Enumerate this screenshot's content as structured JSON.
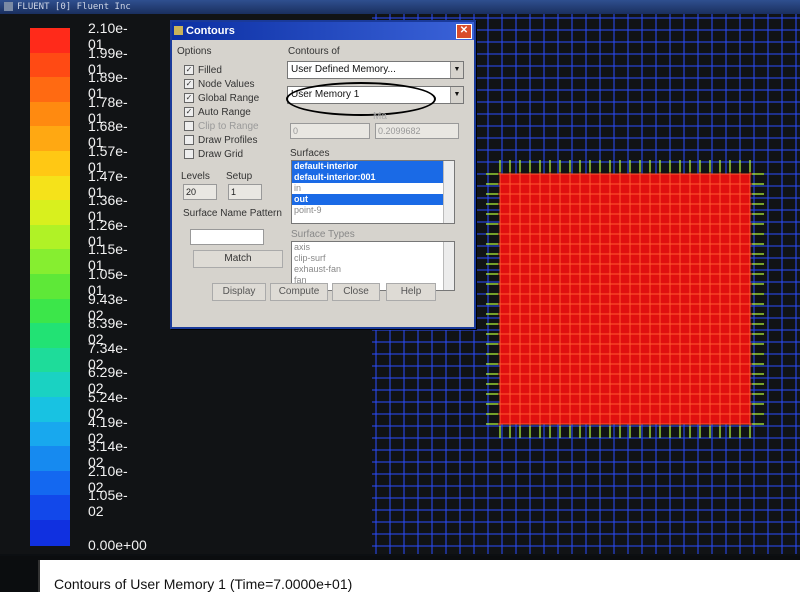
{
  "window": {
    "title": "FLUENT [0] Fluent Inc"
  },
  "colorbar": {
    "labels": [
      "2.10e-01",
      "1.99e-01",
      "1.89e-01",
      "1.78e-01",
      "1.68e-01",
      "1.57e-01",
      "1.47e-01",
      "1.36e-01",
      "1.26e-01",
      "1.15e-01",
      "1.05e-01",
      "9.43e-02",
      "8.39e-02",
      "7.34e-02",
      "6.29e-02",
      "5.24e-02",
      "4.19e-02",
      "3.14e-02",
      "2.10e-02",
      "1.05e-02",
      "0.00e+00"
    ],
    "colors": [
      "#ff2a1a",
      "#ff4a14",
      "#ff6a12",
      "#ff8a10",
      "#ffa812",
      "#ffc814",
      "#f5e21a",
      "#d8f01e",
      "#b0f226",
      "#86ee30",
      "#5ee838",
      "#3ce64a",
      "#22e274",
      "#1edc9a",
      "#1ad2c2",
      "#18c2e2",
      "#18a8ee",
      "#168af0",
      "#1468f0",
      "#1248ea",
      "#1030e0"
    ]
  },
  "dialog": {
    "title": "Contours",
    "options_label": "Options",
    "options": [
      {
        "label": "Filled",
        "checked": true,
        "enabled": true
      },
      {
        "label": "Node Values",
        "checked": true,
        "enabled": true
      },
      {
        "label": "Global Range",
        "checked": true,
        "enabled": true
      },
      {
        "label": "Auto Range",
        "checked": true,
        "enabled": true
      },
      {
        "label": "Clip to Range",
        "checked": false,
        "enabled": false
      },
      {
        "label": "Draw Profiles",
        "checked": false,
        "enabled": true
      },
      {
        "label": "Draw Grid",
        "checked": false,
        "enabled": true
      }
    ],
    "contours_of_label": "Contours of",
    "contours_of_value": "User Defined Memory...",
    "contours_sub_value": "User Memory 1",
    "min_value": "0",
    "max_label": "Ma",
    "max_value": "0.2099682",
    "surfaces_label": "Surfaces",
    "surfaces": [
      {
        "label": "default-interior",
        "selected": true
      },
      {
        "label": "default-interior:001",
        "selected": true
      },
      {
        "label": "in",
        "selected": false
      },
      {
        "label": "out",
        "selected": true
      },
      {
        "label": "point-9",
        "selected": false
      }
    ],
    "levels_label": "Levels",
    "levels_value": "20",
    "setup_label": "Setup",
    "setup_value": "1",
    "surface_name_pattern_label": "Surface Name Pattern",
    "surface_name_pattern_value": "",
    "match_label": "Match",
    "surface_types_label": "Surface Types",
    "surface_types": [
      "axis",
      "clip-surf",
      "exhaust-fan",
      "fan"
    ],
    "buttons": {
      "display": "Display",
      "compute": "Compute",
      "close": "Close",
      "help": "Help"
    }
  },
  "caption": "Contours of User Memory 1  (Time=7.0000e+01)",
  "colors": {
    "hot_region": "#ff2020",
    "mesh": "#2a4cff",
    "dialog_bg": "#d6d3cd",
    "selection": "#1a6ae6"
  }
}
